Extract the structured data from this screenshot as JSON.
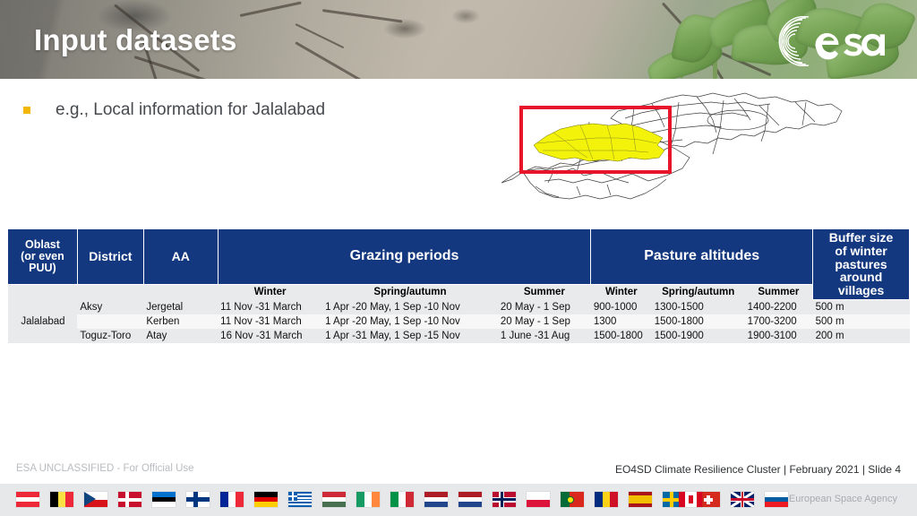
{
  "slide": {
    "title": "Input datasets",
    "bullet": "e.g., Local information for Jalalabad",
    "bullet_marker": "square-bullet"
  },
  "logo": {
    "wordmark": "esa",
    "icon": "esa-arc-logo"
  },
  "map": {
    "name": "kyrgyzstan-admin-map",
    "highlight_region": "Jalalabad",
    "highlight_color": "#f2f20a",
    "selection_box_color": "#e8152a",
    "outline_color": "#3a3a3a"
  },
  "table": {
    "header_bg": "#14387f",
    "headers": {
      "oblast": "Oblast\n(or even PUU)",
      "oblast_line1": "Oblast",
      "oblast_line2": "(or even",
      "oblast_line3": "PUU)",
      "district": "District",
      "aa": "AA",
      "grazing_periods": "Grazing periods",
      "pasture_altitudes": "Pasture altitudes",
      "buffer": "Buffer size of winter pastures around villages",
      "buffer_l1": "Buffer size",
      "buffer_l2": "of winter",
      "buffer_l3": "pastures",
      "buffer_l4": "around",
      "buffer_l5": "villages"
    },
    "subheaders": {
      "grazing_winter": "Winter",
      "grazing_spring_autumn": "Spring/autumn",
      "grazing_summer": "Summer",
      "alt_winter": "Winter",
      "alt_spring_autumn": "Spring/autumn",
      "alt_summer": "Summer"
    },
    "rows": [
      {
        "oblast": "Jalalabad",
        "district": "Aksy",
        "aa": "Jergetal",
        "grazing_winter": "11 Nov -31 March",
        "grazing_spring_autumn": "1 Apr -20 May, 1 Sep -10 Nov",
        "grazing_summer": "20 May - 1 Sep",
        "alt_winter": "900-1000",
        "alt_spring_autumn": "1300-1500",
        "alt_summer": "1400-2200",
        "buffer": "500 m"
      },
      {
        "oblast": "",
        "district": "",
        "aa": "Kerben",
        "grazing_winter": "11 Nov -31 March",
        "grazing_spring_autumn": "1 Apr -20 May, 1 Sep -10 Nov",
        "grazing_summer": "20 May - 1 Sep",
        "alt_winter": "1300",
        "alt_spring_autumn": "1500-1800",
        "alt_summer": "1700-3200",
        "buffer": "500 m"
      },
      {
        "oblast": "",
        "district": "Toguz-Toro",
        "aa": "Atay",
        "grazing_winter": "16 Nov -31 March",
        "grazing_spring_autumn": "1 Apr -31 May, 1 Sep -15 Nov",
        "grazing_summer": "1 June -31 Aug",
        "alt_winter": "1500-1800",
        "alt_spring_autumn": "1500-1900",
        "alt_summer": "1900-3100",
        "buffer": "200 m"
      }
    ]
  },
  "footer": {
    "classification": "ESA UNCLASSIFIED - For Official Use",
    "meta": "EO4SD Climate Resilience Cluster | February 2021 | Slide  4",
    "agency": "European Space Agency",
    "member_flags": [
      "Austria",
      "Belgium",
      "Czech Republic",
      "Denmark",
      "Estonia",
      "Finland",
      "France",
      "Germany",
      "Greece",
      "Hungary",
      "Ireland",
      "Italy",
      "Netherlands",
      "Norway",
      "Poland",
      "Portugal",
      "Romania",
      "Spain",
      "Sweden",
      "Switzerland",
      "United Kingdom",
      "Slovenia"
    ],
    "associate_flags": [
      "Canada"
    ]
  }
}
